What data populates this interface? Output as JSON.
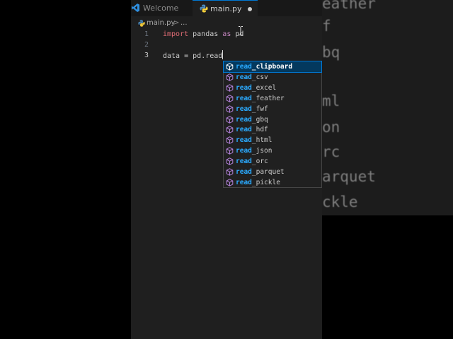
{
  "background": {
    "ghost_fragments": [
      "eather",
      "f",
      "bq",
      "ml",
      "on",
      "rc",
      "arquet",
      "ckle"
    ]
  },
  "tabs": [
    {
      "label": "Welcome",
      "active": false
    },
    {
      "label": "main.py",
      "active": true,
      "dirty": true
    }
  ],
  "breadcrumb": {
    "file": "main.py",
    "separator": ">",
    "more": "..."
  },
  "code": {
    "lines": [
      {
        "number": "1",
        "tokens": [
          {
            "t": "import",
            "c": "kw2"
          },
          {
            "t": " pandas ",
            "c": "txt"
          },
          {
            "t": "as",
            "c": "kw"
          },
          {
            "t": " pd",
            "c": "txt"
          }
        ]
      },
      {
        "number": "2",
        "tokens": []
      },
      {
        "number": "3",
        "tokens": [
          {
            "t": "data ",
            "c": "txt"
          },
          {
            "t": "=",
            "c": "op"
          },
          {
            "t": " pd.read",
            "c": "txt"
          }
        ]
      }
    ],
    "active_line": "3"
  },
  "suggestions": {
    "typed": "read",
    "items": [
      "read_clipboard",
      "read_csv",
      "read_excel",
      "read_feather",
      "read_fwf",
      "read_gbq",
      "read_hdf",
      "read_html",
      "read_json",
      "read_orc",
      "read_parquet",
      "read_pickle"
    ],
    "selected_index": 0,
    "icon": "cube-method-icon"
  },
  "colors": {
    "accent": "#0078d4",
    "selected_bg": "#04395e",
    "match": "#2aaaff",
    "method_icon": "#b180d7",
    "keyword": "#c586c0",
    "import_keyword": "#e06c75"
  }
}
